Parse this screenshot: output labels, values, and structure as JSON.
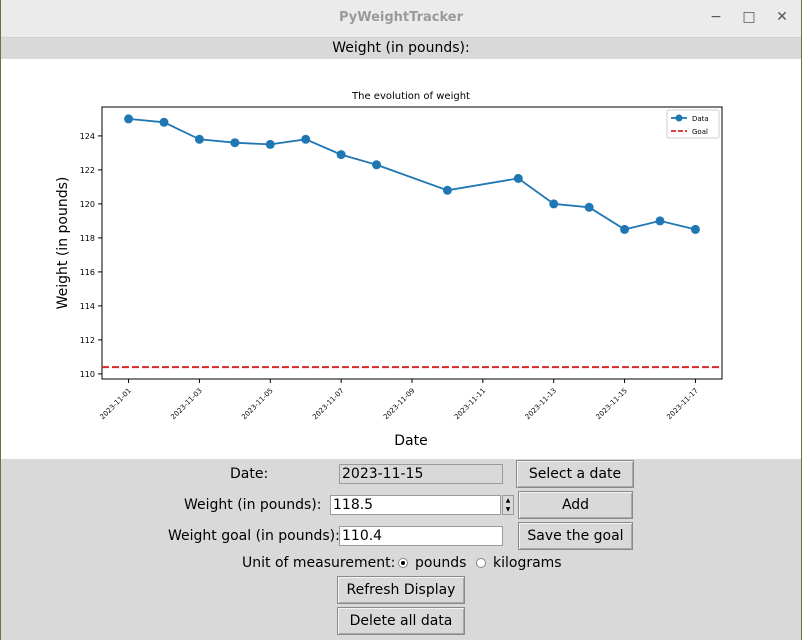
{
  "window": {
    "title": "PyWeightTracker",
    "minimize_glyph": "−",
    "maximize_glyph": "□",
    "close_glyph": "✕"
  },
  "header": {
    "label": "Weight (in pounds):"
  },
  "chart_data": {
    "type": "line",
    "title": "The evolution of weight",
    "xlabel": "Date",
    "ylabel": "Weight (in pounds)",
    "x": [
      "2023-11-01",
      "2023-11-02",
      "2023-11-03",
      "2023-11-04",
      "2023-11-05",
      "2023-11-06",
      "2023-11-07",
      "2023-11-08",
      "2023-11-10",
      "2023-11-12",
      "2023-11-13",
      "2023-11-14",
      "2023-11-15",
      "2023-11-16",
      "2023-11-17"
    ],
    "series": [
      {
        "name": "Data",
        "color": "#1f77b4",
        "values": [
          125.0,
          124.8,
          123.8,
          123.6,
          123.5,
          123.8,
          122.9,
          122.3,
          120.8,
          121.5,
          120.0,
          119.8,
          118.5,
          119.0,
          118.5
        ]
      }
    ],
    "goal": {
      "name": "Goal",
      "value": 110.4,
      "color": "#d62728"
    },
    "xticks": [
      "2023-11-01",
      "2023-11-03",
      "2023-11-05",
      "2023-11-07",
      "2023-11-09",
      "2023-11-11",
      "2023-11-13",
      "2023-11-15",
      "2023-11-17"
    ],
    "yticks": [
      110,
      112,
      114,
      116,
      118,
      120,
      122,
      124
    ],
    "ylim": [
      109.7,
      125.7
    ],
    "xlim": [
      "2023-10-31 06:00",
      "2023-11-17 18:00"
    ],
    "legend": "top-right",
    "grid": false
  },
  "form": {
    "date_label": "Date:",
    "date_value": "2023-11-15",
    "select_date_button": "Select a date",
    "weight_label": "Weight (in pounds):",
    "weight_value": "118.5",
    "add_button": "Add",
    "goal_label": "Weight goal (in pounds):",
    "goal_value": "110.4",
    "save_goal_button": "Save the goal",
    "unit_label": "Unit of measurement:",
    "unit_options": [
      "pounds",
      "kilograms"
    ],
    "unit_selected": "pounds",
    "refresh_button": "Refresh Display",
    "delete_button": "Delete all data"
  }
}
